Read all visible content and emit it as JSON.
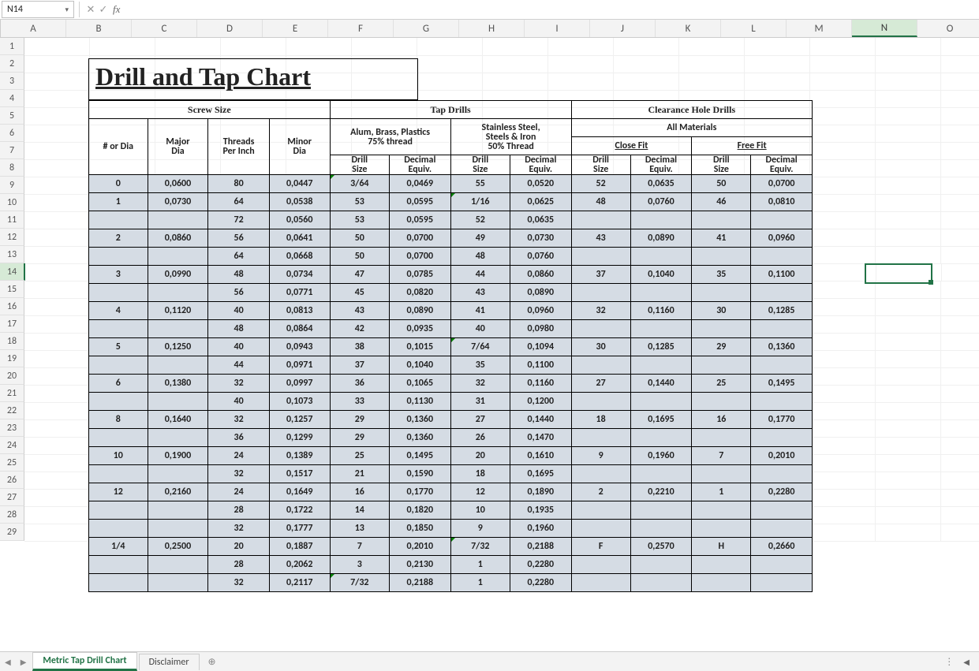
{
  "namebox": "N14",
  "fx_cancel": "✕",
  "fx_enter": "✓",
  "fx_label": "fx",
  "columns": [
    "A",
    "B",
    "C",
    "D",
    "E",
    "F",
    "G",
    "H",
    "I",
    "J",
    "K",
    "L",
    "M",
    "N",
    "O"
  ],
  "selected_col": "N",
  "selected_row": 14,
  "rownums": [
    1,
    2,
    3,
    4,
    5,
    6,
    7,
    8,
    9,
    10,
    11,
    12,
    13,
    14,
    15,
    16,
    17,
    18,
    19,
    20,
    21,
    22,
    23,
    24,
    25,
    26,
    27,
    28,
    29
  ],
  "title": "Drill and Tap Chart",
  "sections": {
    "screw": "Screw Size",
    "tap": "Tap Drills",
    "clear": "Clearance Hole Drills"
  },
  "sub": {
    "alum1": "Alum, Brass, Plastics",
    "alum2": "75% thread",
    "steel1": "Stainless Steel,",
    "steel2": "Steels & Iron",
    "steel3": "50% Thread",
    "allmat": "All Materials",
    "close": "Close Fit",
    "free": "Free Fit",
    "numdia": "# or Dia",
    "major": "Major",
    "major2": "Dia",
    "tpi": "Threads",
    "tpi2": "Per Inch",
    "minor": "Minor",
    "minor2": "Dia",
    "ds": "Drill",
    "ds2": "Size",
    "de": "Decimal",
    "de2": "Equiv."
  },
  "rows": [
    {
      "a": "0",
      "b": "0,0600",
      "c": "80",
      "d": "0,0447",
      "e": "3/64",
      "f": "0,0469",
      "g": "55",
      "h": "0,0520",
      "i": "52",
      "j": "0,0635",
      "k": "50",
      "l": "0,0700",
      "gt": [
        "e"
      ]
    },
    {
      "a": "1",
      "b": "0,0730",
      "c": "64",
      "d": "0,0538",
      "e": "53",
      "f": "0,0595",
      "g": "1/16",
      "h": "0,0625",
      "i": "48",
      "j": "0,0760",
      "k": "46",
      "l": "0,0810",
      "gt": [
        "g"
      ]
    },
    {
      "a": "",
      "b": "",
      "c": "72",
      "d": "0,0560",
      "e": "53",
      "f": "0,0595",
      "g": "52",
      "h": "0,0635",
      "i": "",
      "j": "",
      "k": "",
      "l": ""
    },
    {
      "a": "2",
      "b": "0,0860",
      "c": "56",
      "d": "0,0641",
      "e": "50",
      "f": "0,0700",
      "g": "49",
      "h": "0,0730",
      "i": "43",
      "j": "0,0890",
      "k": "41",
      "l": "0,0960"
    },
    {
      "a": "",
      "b": "",
      "c": "64",
      "d": "0,0668",
      "e": "50",
      "f": "0,0700",
      "g": "48",
      "h": "0,0760",
      "i": "",
      "j": "",
      "k": "",
      "l": ""
    },
    {
      "a": "3",
      "b": "0,0990",
      "c": "48",
      "d": "0,0734",
      "e": "47",
      "f": "0,0785",
      "g": "44",
      "h": "0,0860",
      "i": "37",
      "j": "0,1040",
      "k": "35",
      "l": "0,1100"
    },
    {
      "a": "",
      "b": "",
      "c": "56",
      "d": "0,0771",
      "e": "45",
      "f": "0,0820",
      "g": "43",
      "h": "0,0890",
      "i": "",
      "j": "",
      "k": "",
      "l": ""
    },
    {
      "a": "4",
      "b": "0,1120",
      "c": "40",
      "d": "0,0813",
      "e": "43",
      "f": "0,0890",
      "g": "41",
      "h": "0,0960",
      "i": "32",
      "j": "0,1160",
      "k": "30",
      "l": "0,1285"
    },
    {
      "a": "",
      "b": "",
      "c": "48",
      "d": "0,0864",
      "e": "42",
      "f": "0,0935",
      "g": "40",
      "h": "0,0980",
      "i": "",
      "j": "",
      "k": "",
      "l": ""
    },
    {
      "a": "5",
      "b": "0,1250",
      "c": "40",
      "d": "0,0943",
      "e": "38",
      "f": "0,1015",
      "g": "7/64",
      "h": "0,1094",
      "i": "30",
      "j": "0,1285",
      "k": "29",
      "l": "0,1360",
      "gt": [
        "g"
      ]
    },
    {
      "a": "",
      "b": "",
      "c": "44",
      "d": "0,0971",
      "e": "37",
      "f": "0,1040",
      "g": "35",
      "h": "0,1100",
      "i": "",
      "j": "",
      "k": "",
      "l": ""
    },
    {
      "a": "6",
      "b": "0,1380",
      "c": "32",
      "d": "0,0997",
      "e": "36",
      "f": "0,1065",
      "g": "32",
      "h": "0,1160",
      "i": "27",
      "j": "0,1440",
      "k": "25",
      "l": "0,1495"
    },
    {
      "a": "",
      "b": "",
      "c": "40",
      "d": "0,1073",
      "e": "33",
      "f": "0,1130",
      "g": "31",
      "h": "0,1200",
      "i": "",
      "j": "",
      "k": "",
      "l": ""
    },
    {
      "a": "8",
      "b": "0,1640",
      "c": "32",
      "d": "0,1257",
      "e": "29",
      "f": "0,1360",
      "g": "27",
      "h": "0,1440",
      "i": "18",
      "j": "0,1695",
      "k": "16",
      "l": "0,1770"
    },
    {
      "a": "",
      "b": "",
      "c": "36",
      "d": "0,1299",
      "e": "29",
      "f": "0,1360",
      "g": "26",
      "h": "0,1470",
      "i": "",
      "j": "",
      "k": "",
      "l": ""
    },
    {
      "a": "10",
      "b": "0,1900",
      "c": "24",
      "d": "0,1389",
      "e": "25",
      "f": "0,1495",
      "g": "20",
      "h": "0,1610",
      "i": "9",
      "j": "0,1960",
      "k": "7",
      "l": "0,2010"
    },
    {
      "a": "",
      "b": "",
      "c": "32",
      "d": "0,1517",
      "e": "21",
      "f": "0,1590",
      "g": "18",
      "h": "0,1695",
      "i": "",
      "j": "",
      "k": "",
      "l": ""
    },
    {
      "a": "12",
      "b": "0,2160",
      "c": "24",
      "d": "0,1649",
      "e": "16",
      "f": "0,1770",
      "g": "12",
      "h": "0,1890",
      "i": "2",
      "j": "0,2210",
      "k": "1",
      "l": "0,2280"
    },
    {
      "a": "",
      "b": "",
      "c": "28",
      "d": "0,1722",
      "e": "14",
      "f": "0,1820",
      "g": "10",
      "h": "0,1935",
      "i": "",
      "j": "",
      "k": "",
      "l": ""
    },
    {
      "a": "",
      "b": "",
      "c": "32",
      "d": "0,1777",
      "e": "13",
      "f": "0,1850",
      "g": "9",
      "h": "0,1960",
      "i": "",
      "j": "",
      "k": "",
      "l": ""
    },
    {
      "a": "1/4",
      "b": "0,2500",
      "c": "20",
      "d": "0,1887",
      "e": "7",
      "f": "0,2010",
      "g": "7/32",
      "h": "0,2188",
      "i": "F",
      "j": "0,2570",
      "k": "H",
      "l": "0,2660",
      "gt": [
        "g"
      ]
    },
    {
      "a": "",
      "b": "",
      "c": "28",
      "d": "0,2062",
      "e": "3",
      "f": "0,2130",
      "g": "1",
      "h": "0,2280",
      "i": "",
      "j": "",
      "k": "",
      "l": ""
    },
    {
      "a": "",
      "b": "",
      "c": "32",
      "d": "0,2117",
      "e": "7/32",
      "f": "0,2188",
      "g": "1",
      "h": "0,2280",
      "i": "",
      "j": "",
      "k": "",
      "l": "",
      "gt": [
        "e"
      ]
    }
  ],
  "tabs": {
    "active": "Metric Tap Drill Chart",
    "other": "Disclaimer"
  }
}
